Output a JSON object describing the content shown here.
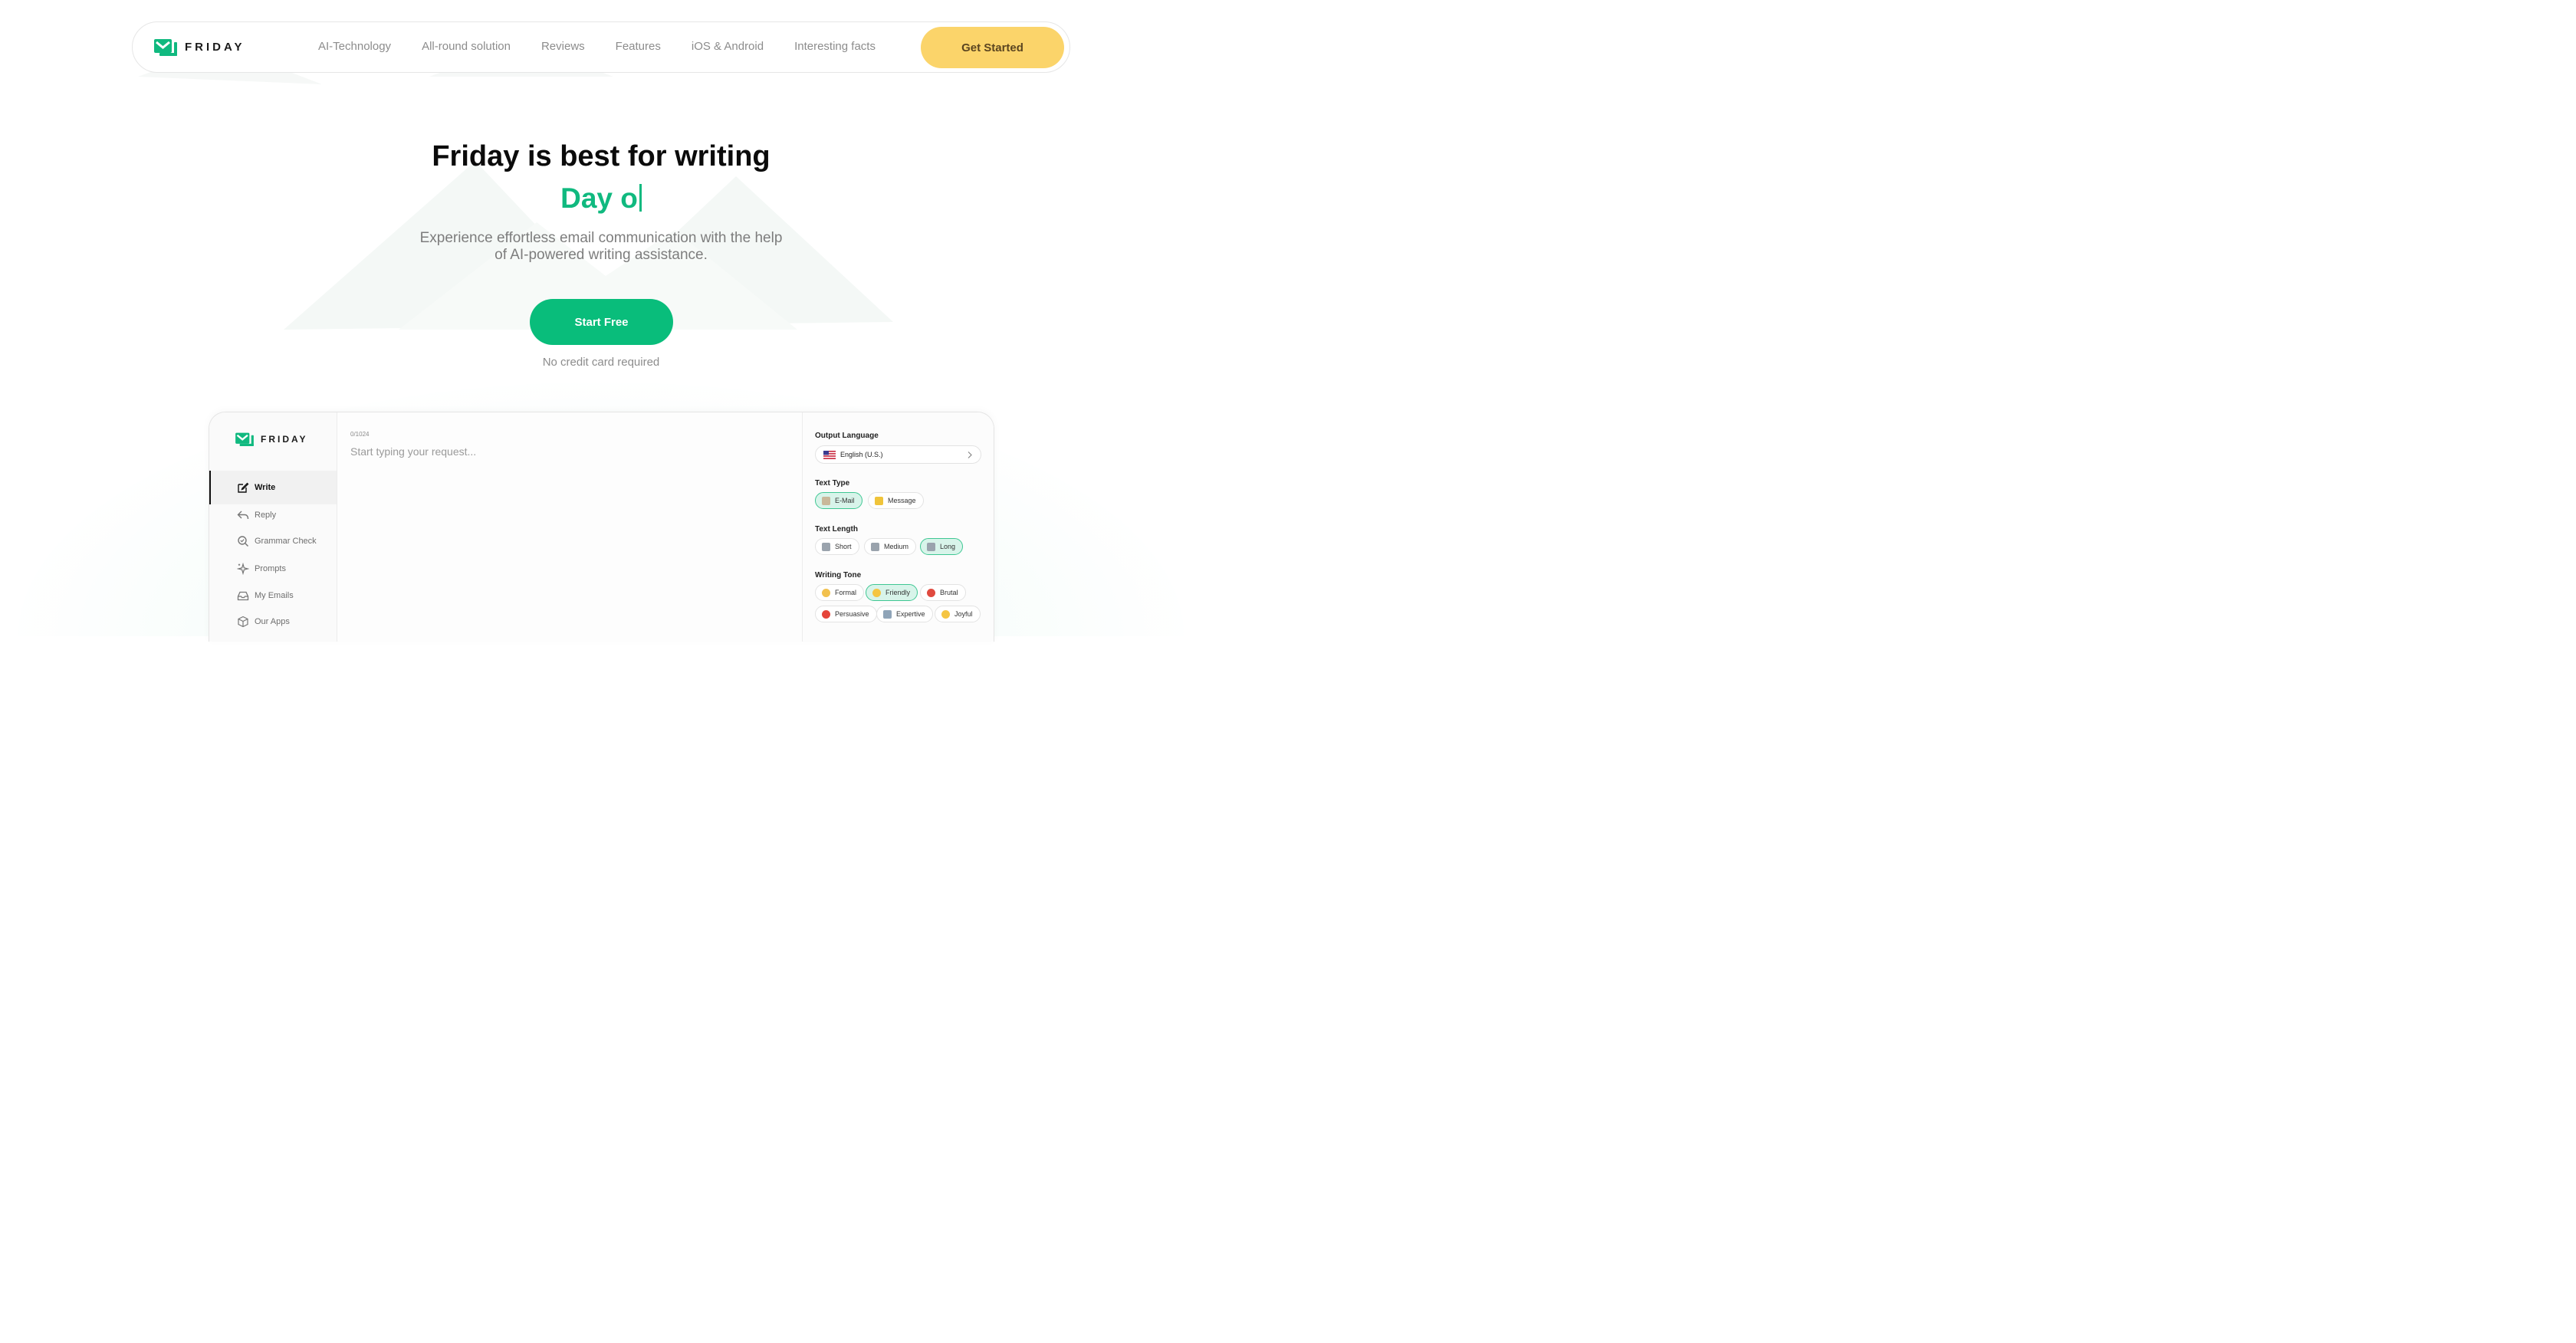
{
  "brand": {
    "name": "FRIDAY",
    "accent": "#10b97f"
  },
  "nav": {
    "links": [
      "AI-Technology",
      "All-round solution",
      "Reviews",
      "Features",
      "iOS & Android",
      "Interesting facts"
    ],
    "cta": "Get Started"
  },
  "hero": {
    "title": "Friday is best for writing",
    "typed": "Day o",
    "subtitle_line1": "Experience effortless email communication with the help",
    "subtitle_line2": "of AI-powered writing assistance.",
    "cta": "Start Free",
    "note": "No credit card required"
  },
  "app": {
    "brand": "FRIDAY",
    "sidebar": [
      {
        "label": "Write",
        "icon": "edit-icon",
        "active": true
      },
      {
        "label": "Reply",
        "icon": "reply-icon"
      },
      {
        "label": "Grammar Check",
        "icon": "magnify-check-icon"
      },
      {
        "label": "Prompts",
        "icon": "sparkle-icon"
      },
      {
        "label": "My Emails",
        "icon": "inbox-icon"
      },
      {
        "label": "Our Apps",
        "icon": "cube-icon"
      }
    ],
    "editor": {
      "counter": "0/1024",
      "placeholder": "Start typing your request..."
    },
    "settings": {
      "output_language": {
        "label": "Output Language",
        "value": "English (U.S.)"
      },
      "text_type": {
        "label": "Text Type",
        "options": [
          "E-Mail",
          "Message"
        ],
        "selected": "E-Mail"
      },
      "text_length": {
        "label": "Text Length",
        "options": [
          "Short",
          "Medium",
          "Long"
        ],
        "selected": "Long"
      },
      "writing_tone": {
        "label": "Writing Tone",
        "options": [
          "Formal",
          "Friendly",
          "Brutal",
          "Persuasive",
          "Expertive",
          "Joyful"
        ],
        "selected": "Friendly"
      }
    }
  }
}
